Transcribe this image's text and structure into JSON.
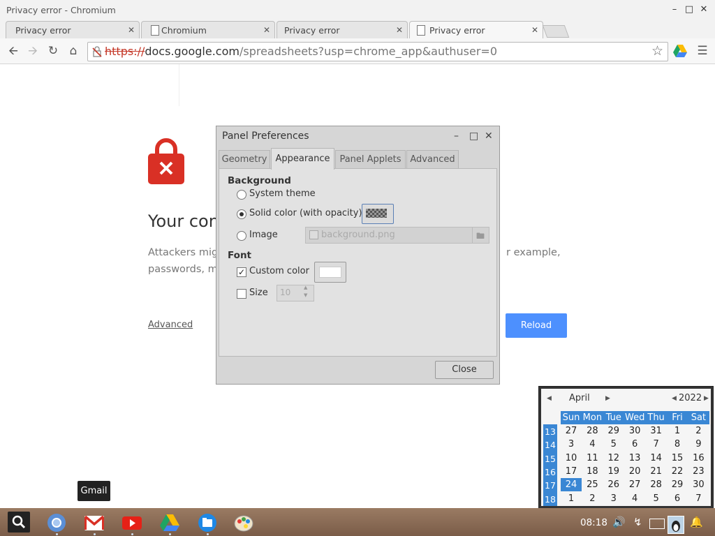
{
  "window": {
    "title": "Privacy error - Chromium"
  },
  "tabs": [
    {
      "label": "Privacy error",
      "icon": "none",
      "active": false
    },
    {
      "label": "Chromium",
      "icon": "document-icon",
      "active": false
    },
    {
      "label": "Privacy error",
      "icon": "none",
      "active": false
    },
    {
      "label": "Privacy error",
      "icon": "document-icon",
      "active": true
    }
  ],
  "omnibox": {
    "scheme": "https://",
    "host": "docs.google.com",
    "path": "/spreadsheets?usp=chrome_app&authuser=0"
  },
  "page": {
    "heading": "Your con",
    "description_line1": "Attackers migh",
    "description_line1_tail": "r example,",
    "description_line2": "passwords, me",
    "advanced_link": "Advanced",
    "reload_button": "Reload",
    "accent_color": "#4d90fe",
    "lock_color": "#d93025"
  },
  "dialog": {
    "title": "Panel Preferences",
    "tabs": [
      "Geometry",
      "Appearance",
      "Panel Applets",
      "Advanced"
    ],
    "active_tab": "Appearance",
    "background_section": "Background",
    "options": {
      "system_theme": "System theme",
      "solid_color": "Solid color (with opacity)",
      "image": "Image"
    },
    "selected_background": "Solid color (with opacity)",
    "image_file": "background.png",
    "font_section": "Font",
    "custom_color_label": "Custom color",
    "custom_color_checked": true,
    "size_label": "Size",
    "size_checked": false,
    "size_value": "10",
    "close_button": "Close"
  },
  "calendar": {
    "month": "April",
    "year": "2022",
    "day_names": [
      "Sun",
      "Mon",
      "Tue",
      "Wed",
      "Thu",
      "Fri",
      "Sat"
    ],
    "weeks": [
      {
        "num": "13",
        "days": [
          "27",
          "28",
          "29",
          "30",
          "31",
          "1",
          "2"
        ]
      },
      {
        "num": "14",
        "days": [
          "3",
          "4",
          "5",
          "6",
          "7",
          "8",
          "9"
        ]
      },
      {
        "num": "15",
        "days": [
          "10",
          "11",
          "12",
          "13",
          "14",
          "15",
          "16"
        ]
      },
      {
        "num": "16",
        "days": [
          "17",
          "18",
          "19",
          "20",
          "21",
          "22",
          "23"
        ]
      },
      {
        "num": "17",
        "days": [
          "24",
          "25",
          "26",
          "27",
          "28",
          "29",
          "30"
        ]
      },
      {
        "num": "18",
        "days": [
          "1",
          "2",
          "3",
          "4",
          "5",
          "6",
          "7"
        ]
      }
    ],
    "selected_day": "24"
  },
  "tooltip": {
    "text": "Gmail"
  },
  "shelf": {
    "apps": [
      "chromium-icon",
      "gmail-icon",
      "youtube-icon",
      "drive-icon",
      "files-icon",
      "paint-icon"
    ],
    "clock": "08:18"
  }
}
